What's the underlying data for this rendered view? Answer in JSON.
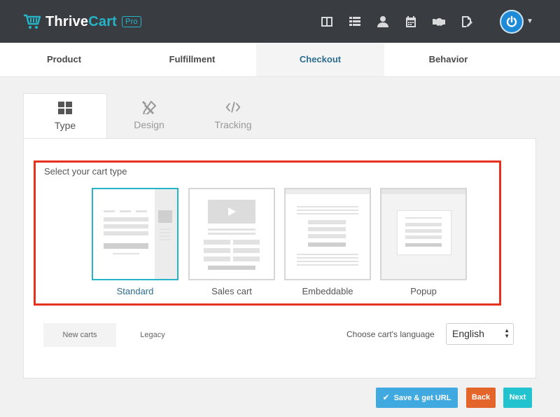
{
  "brand": {
    "name_part1": "Thrive",
    "name_part2": "Cart",
    "badge": "Pro",
    "accent": "#26b5c8"
  },
  "topnav": {
    "icons": [
      "layout-icon",
      "list-icon",
      "user-icon",
      "calendar-icon",
      "handshake-icon",
      "signature-icon"
    ]
  },
  "main_tabs": [
    {
      "label": "Product"
    },
    {
      "label": "Fulfillment"
    },
    {
      "label": "Checkout",
      "active": true
    },
    {
      "label": "Behavior"
    }
  ],
  "sub_tabs": [
    {
      "label": "Type",
      "icon": "grid-icon",
      "active": true
    },
    {
      "label": "Design",
      "icon": "design-tools-icon"
    },
    {
      "label": "Tracking",
      "icon": "code-icon"
    }
  ],
  "cart_type": {
    "label": "Select your cart type",
    "options": [
      {
        "label": "Standard",
        "active": true
      },
      {
        "label": "Sales cart"
      },
      {
        "label": "Embeddable"
      },
      {
        "label": "Popup"
      }
    ]
  },
  "version_tabs": [
    {
      "label": "New carts",
      "active": true
    },
    {
      "label": "Legacy"
    }
  ],
  "language": {
    "label": "Choose cart's language",
    "value": "English"
  },
  "buttons": {
    "save": "Save & get URL",
    "back": "Back",
    "next": "Next"
  },
  "colors": {
    "highlight": "#e5311d",
    "save": "#3fa9e0",
    "back": "#e4652a",
    "next": "#22c3cf"
  }
}
